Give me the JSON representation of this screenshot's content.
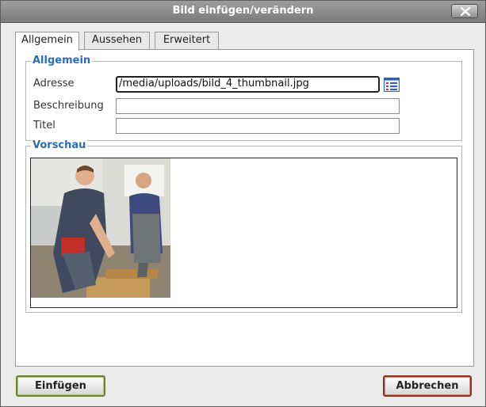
{
  "window": {
    "title": "Bild einfügen/verändern"
  },
  "tabs": [
    {
      "label": "Allgemein",
      "active": true
    },
    {
      "label": "Aussehen",
      "active": false
    },
    {
      "label": "Erweitert",
      "active": false
    }
  ],
  "general": {
    "legend": "Allgemein",
    "address_label": "Adresse",
    "address_value": "/media/uploads/bild_4_thumbnail.jpg",
    "description_label": "Beschreibung",
    "description_value": "",
    "title_label": "Titel",
    "title_value": ""
  },
  "preview": {
    "legend": "Vorschau"
  },
  "buttons": {
    "insert": "Einfügen",
    "cancel": "Abbrechen"
  },
  "icons": {
    "close": "close-icon",
    "browse": "file-browser-icon"
  },
  "colors": {
    "legend": "#2b6cb6",
    "insert_border": "#6f7f39",
    "cancel_border": "#8b3326"
  }
}
